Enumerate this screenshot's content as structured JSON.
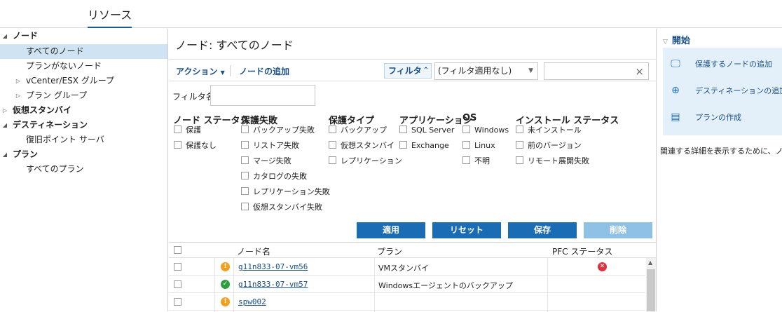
{
  "page": {
    "title": "リソース"
  },
  "tree": {
    "items": [
      {
        "label": "ノード",
        "level": 0,
        "expanded": true,
        "bold": true,
        "selected": false
      },
      {
        "label": "すべてのノード",
        "level": 1,
        "expanded": null,
        "bold": false,
        "selected": true
      },
      {
        "label": "プランがないノード",
        "level": 1,
        "expanded": null,
        "bold": false,
        "selected": false
      },
      {
        "label": "vCenter/ESX グループ",
        "level": 1,
        "expanded": false,
        "bold": false,
        "selected": false
      },
      {
        "label": "プラン グループ",
        "level": 1,
        "expanded": false,
        "bold": false,
        "selected": false
      },
      {
        "label": "仮想スタンバイ",
        "level": 0,
        "expanded": false,
        "bold": true,
        "selected": false
      },
      {
        "label": "デスティネーション",
        "level": 0,
        "expanded": true,
        "bold": true,
        "selected": false
      },
      {
        "label": "復旧ポイント サーバ",
        "level": 1,
        "expanded": null,
        "bold": false,
        "selected": false
      },
      {
        "label": "プラン",
        "level": 0,
        "expanded": true,
        "bold": true,
        "selected": false
      },
      {
        "label": "すべてのプラン",
        "level": 1,
        "expanded": null,
        "bold": false,
        "selected": false
      }
    ]
  },
  "center": {
    "title": "ノード: すべてのノード",
    "toolbar": {
      "action_label": "アクション",
      "add_node_label": "ノードの追加",
      "filter_label": "フィルタ",
      "filter_select": "(フィルタ適用なし)",
      "search_value": ""
    },
    "filter_name_label": "フィルタ名",
    "filter_name_value": "",
    "groups": [
      {
        "title": "ノード ステータス",
        "items": [
          "保護",
          "保護なし"
        ]
      },
      {
        "title": "保護失敗",
        "items": [
          "バックアップ失敗",
          "リストア失敗",
          "マージ失敗",
          "カタログの失敗",
          "レプリケーション失敗",
          "仮想スタンバイ失敗"
        ]
      },
      {
        "title": "保護タイプ",
        "items": [
          "バックアップ",
          "仮想スタンバイ",
          "レプリケーション"
        ]
      },
      {
        "title": "アプリケーション",
        "items": [
          "SQL Server",
          "Exchange"
        ]
      },
      {
        "title": "OS",
        "items": [
          "Windows",
          "Linux",
          "不明"
        ]
      },
      {
        "title": "インストール ステータス",
        "items": [
          "未インストール",
          "前のバージョン",
          "リモート展開失敗"
        ]
      }
    ],
    "buttons": {
      "apply": "適用",
      "reset": "リセット",
      "save": "保存",
      "delete": "削除"
    },
    "grid": {
      "headers": {
        "node_name": "ノード名",
        "plan": "プラン",
        "pfc_status": "PFC ステータス"
      },
      "rows": [
        {
          "status": "warning",
          "node_name": "g11n833-07-vm56",
          "plan": "VMスタンバイ",
          "pfc": "error"
        },
        {
          "status": "ok",
          "node_name": "g11n833-07-vm57",
          "plan": "Windowsエージェントのバックアップ",
          "pfc": ""
        },
        {
          "status": "warning",
          "node_name": "spw002",
          "plan": "",
          "pfc": ""
        }
      ]
    }
  },
  "right": {
    "title": "開始",
    "items": [
      {
        "label": "保護するノードの追加",
        "icon": "monitor-icon"
      },
      {
        "label": "デスティネーションの追加",
        "icon": "target-icon"
      },
      {
        "label": "プランの作成",
        "icon": "plan-icon"
      }
    ],
    "note": "関連する詳細を表示するために、ノー"
  },
  "colors": {
    "accent": "#1a6db5",
    "link": "#1a4f86",
    "selected": "#cfe3f3",
    "warning": "#f0a020",
    "ok": "#2e9e3e",
    "error": "#d9333f"
  }
}
